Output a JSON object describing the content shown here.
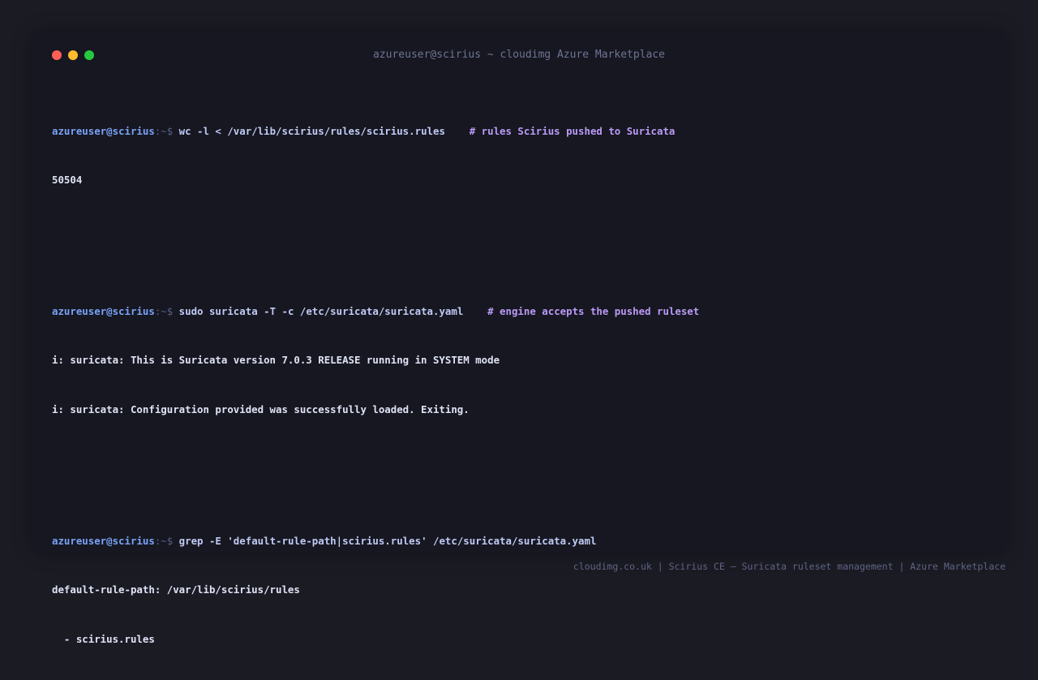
{
  "window": {
    "title": "azureuser@scirius ~ cloudimg Azure Marketplace"
  },
  "terminal": {
    "blocks": [
      {
        "prompt_user": "azureuser@scirius",
        "prompt_path": ":~$ ",
        "command": "wc -l < /var/lib/scirius/rules/scirius.rules",
        "comment": "    # rules Scirius pushed to Suricata",
        "output": [
          "50504"
        ]
      },
      {
        "prompt_user": "azureuser@scirius",
        "prompt_path": ":~$ ",
        "command": "sudo suricata -T -c /etc/suricata/suricata.yaml",
        "comment": "    # engine accepts the pushed ruleset",
        "output": [
          "i: suricata: This is Suricata version 7.0.3 RELEASE running in SYSTEM mode",
          "i: suricata: Configuration provided was successfully loaded. Exiting."
        ]
      },
      {
        "prompt_user": "azureuser@scirius",
        "prompt_path": ":~$ ",
        "command": "grep -E 'default-rule-path|scirius.rules' /etc/suricata/suricata.yaml",
        "comment": "",
        "output": [
          "default-rule-path: /var/lib/scirius/rules",
          "  - scirius.rules"
        ]
      }
    ]
  },
  "footer": {
    "text": "cloudimg.co.uk | Scirius CE — Suricata ruleset management | Azure Marketplace"
  },
  "colors": {
    "close": "#ff5f57",
    "minimize": "#febc2e",
    "maximize": "#28c840",
    "prompt_user": "#7aa2f7",
    "comment": "#bb9af7"
  }
}
